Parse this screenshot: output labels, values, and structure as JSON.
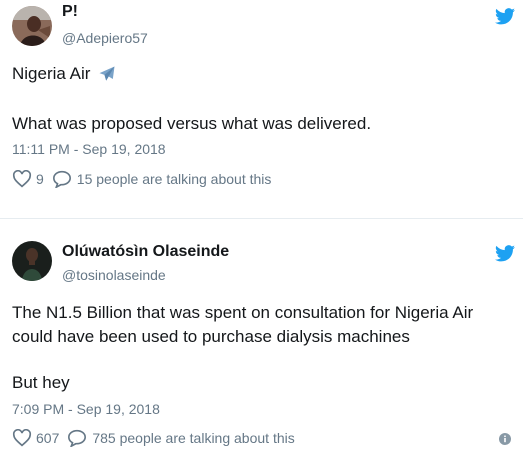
{
  "tweets": [
    {
      "display_name": "P!",
      "handle": "@Adepiero57",
      "text_line1": "Nigeria Air",
      "emoji_icon": "airplane-icon",
      "text_line2": "What was proposed versus what was delivered.",
      "timestamp": "11:11 PM - Sep 19, 2018",
      "likes": "9",
      "talking": "15 people are talking about this"
    },
    {
      "display_name": "Olúwatósìn Olaseinde",
      "handle": "@tosinolaseinde",
      "text_line1": "The N1.5 Billion that was spent on consultation for Nigeria Air",
      "text_line2": "could have been used to purchase dialysis machines",
      "text_line3": "But hey",
      "timestamp": "7:09 PM - Sep 19, 2018",
      "likes": "607",
      "talking": "785 people are talking about this"
    }
  ],
  "colors": {
    "twitter_blue": "#1da1f2",
    "text": "#14171a",
    "secondary": "#657786",
    "divider": "#e6ecf0"
  }
}
